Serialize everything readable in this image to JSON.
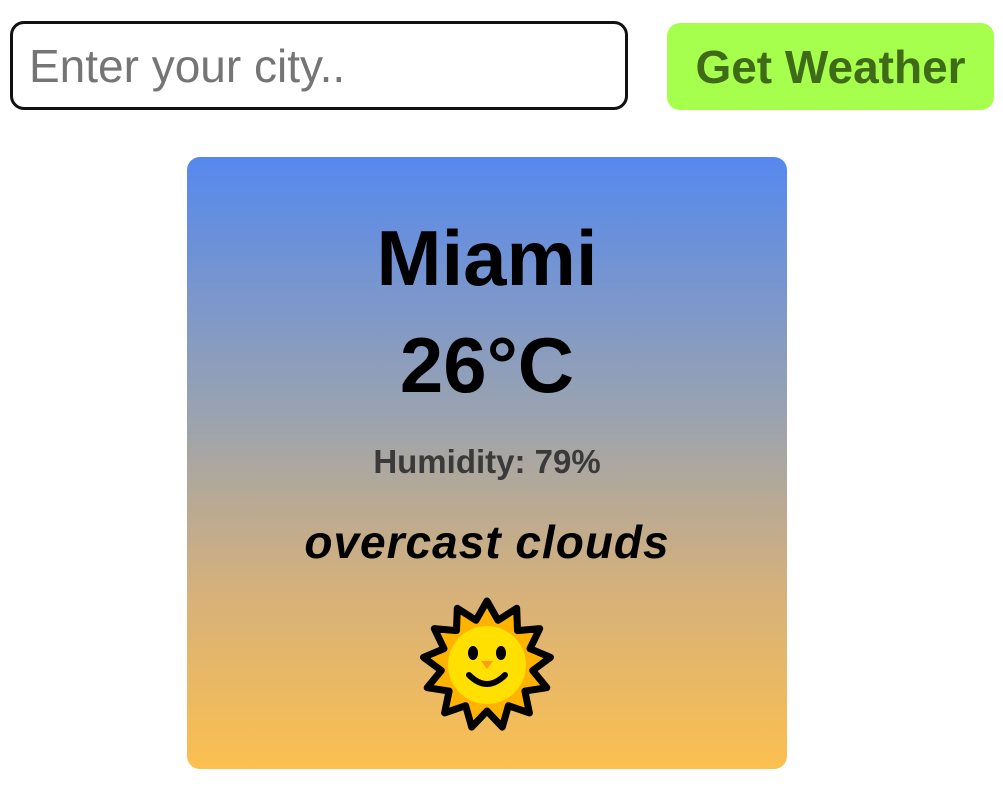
{
  "search": {
    "placeholder": "Enter your city..",
    "value": ""
  },
  "button": {
    "label": "Get Weather"
  },
  "weather": {
    "city": "Miami",
    "temperature": "26°C",
    "humidity": "Humidity: 79%",
    "condition": "overcast clouds",
    "icon": "sun-with-face-icon"
  },
  "colors": {
    "button_bg": "#a6ff4d",
    "button_text": "#3f6b18",
    "card_gradient_top": "#5588ee",
    "card_gradient_bottom": "#fcc050"
  }
}
